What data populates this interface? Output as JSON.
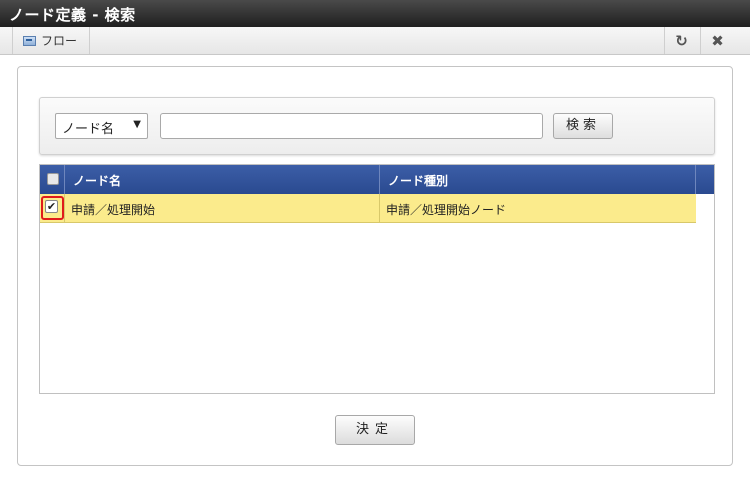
{
  "window": {
    "title": "ノード定義 - 検索"
  },
  "toolbar": {
    "flow_label": "フロー",
    "flow_icon": "flow-icon",
    "refresh_icon": "refresh-icon",
    "close_icon": "close-icon"
  },
  "search": {
    "field_select_value": "ノード名",
    "input_value": "",
    "button_label": "検索"
  },
  "grid": {
    "columns": [
      "ノード名",
      "ノード種別"
    ],
    "rows": [
      {
        "checked": true,
        "node_name": "申請／処理開始",
        "node_type": "申請／処理開始ノード"
      }
    ]
  },
  "footer": {
    "decide_label": "決定"
  },
  "colors": {
    "header_bg": "#2f4f96",
    "selected_row": "#fbeb8c",
    "highlight": "#e01b1b"
  }
}
